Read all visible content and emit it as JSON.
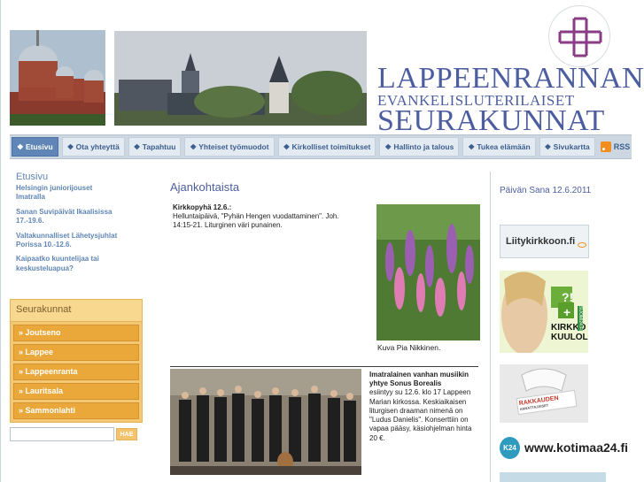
{
  "header": {
    "logo_line1": "LAPPEENRANNAN",
    "logo_line2": "EVANKELISLUTERILAISET",
    "logo_line3": "SEURAKUNNAT"
  },
  "nav": {
    "items": [
      {
        "label": "❖ Etusivu"
      },
      {
        "label": "❖ Ota yhteyttä"
      },
      {
        "label": "❖ Tapahtuu"
      },
      {
        "label": "❖ Yhteiset työmuodot"
      },
      {
        "label": "❖ Kirkolliset toimitukset"
      },
      {
        "label": "❖ Hallinto ja talous"
      },
      {
        "label": "❖ Tukea elämään"
      },
      {
        "label": "❖ Sivukartta"
      }
    ],
    "rss_label": "RSS"
  },
  "sidebar": {
    "title": "Etusivu",
    "links": [
      {
        "label": "Helsingin juniorijouset Imatralla"
      },
      {
        "label": "Sanan Suvipäivät Ikaalisissa 17.-19.6."
      },
      {
        "label": "Valtakunnalliset Lähetysjuhlat Porissa 10.-12.6."
      },
      {
        "label": "Kaipaatko kuuntelijaa tai keskusteluapua?"
      }
    ]
  },
  "parishes": {
    "title": "Seurakunnat",
    "items": [
      {
        "label": "» Joutseno"
      },
      {
        "label": "» Lappee"
      },
      {
        "label": "» Lappeenranta"
      },
      {
        "label": "» Lauritsala"
      },
      {
        "label": "» Sammonlahti"
      }
    ]
  },
  "search": {
    "placeholder": "",
    "button_label": "HAE"
  },
  "main": {
    "title": "Ajankohtaista",
    "news1_title": "Kirkkopyhä 12.6.:",
    "news1_text": "Helluntaipäivä, \"Pyhän Hengen vuodattaminen\". Joh. 14:15-21. Liturginen väri punainen.",
    "photo_caption": "Kuva Pia Nikkinen.",
    "news2_title": "Imatralainen vanhan musiikin yhtye Sonus Borealis",
    "news2_text": "esiintyy su 12.6. klo 17 Lappeen Marian kirkossa. Keskiaikaisen liturgisen draaman nimenä on \"Ludus Danielis\". Konserttiin on vapaa pääsy, käsiohjelman hinta 20 €."
  },
  "right": {
    "day_word": "Päivän Sana 12.6.2011",
    "banner1_text": "Liitykirkkoon.fi",
    "banner2_text1": "KIRKKO",
    "banner2_text2": "KUULOLLA",
    "banner2_side": "SUOMI24.FI",
    "banner3_text1": "RAKKAUDEN",
    "banner3_text2": "ANNATTAJAISET",
    "banner4_badge": "K24",
    "banner4_text": "www.kotimaa24.fi"
  },
  "colors": {
    "accent_blue": "#5f86b6",
    "logo_purple": "#4d5ea0",
    "parish_orange": "#eaa83a"
  }
}
